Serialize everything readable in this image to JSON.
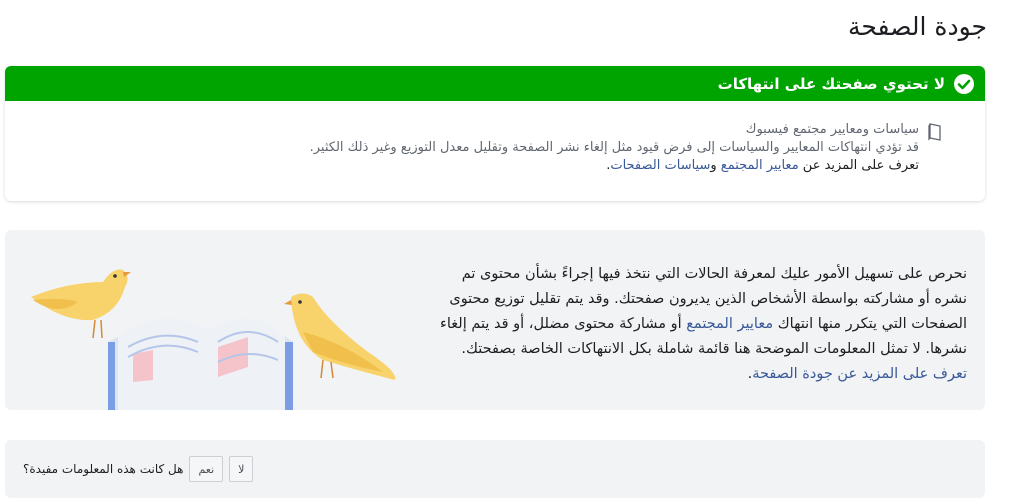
{
  "page": {
    "title": "جودة الصفحة"
  },
  "status": {
    "banner_text": "لا تحتوي صفحتك على انتهاكات",
    "policy_heading": "سياسات ومعايير مجتمع فيسبوك",
    "policy_description": "قد تؤدي انتهاكات المعايير والسياسات إلى فرض قيود مثل إلغاء نشر الصفحة وتقليل معدل التوزيع وغير ذلك الكثير.",
    "learn_more_prefix": "تعرف على المزيد عن ",
    "community_standards_link": "معايير المجتمع",
    "and_word": " و",
    "pages_policies_link": "سياسات الصفحات",
    "period": "."
  },
  "info": {
    "part1": "نحرص على تسهيل الأمور عليك لمعرفة الحالات التي نتخذ فيها إجراءً بشأن محتوى تم نشره أو مشاركته بواسطة الأشخاص الذين يديرون صفحتك. وقد يتم تقليل توزيع محتوى الصفحات التي يتكرر منها انتهاك ",
    "community_standards_link": "معايير المجتمع",
    "part2": " أو مشاركة محتوى مضلل، أو قد يتم إلغاء نشرها. لا تمثل المعلومات الموضحة هنا قائمة شاملة بكل الانتهاكات الخاصة بصفحتك. ",
    "learn_more_link": "تعرف على المزيد عن جودة الصفحة",
    "period": "."
  },
  "feedback": {
    "question": "هل كانت هذه المعلومات مفيدة؟",
    "yes_label": "نعم",
    "no_label": "لا"
  },
  "colors": {
    "success_green": "#00a400",
    "link_blue": "#385898",
    "card_gray": "#f2f3f5"
  },
  "icons": [
    "check-circle-icon",
    "book-icon",
    "birds-book-illustration"
  ]
}
